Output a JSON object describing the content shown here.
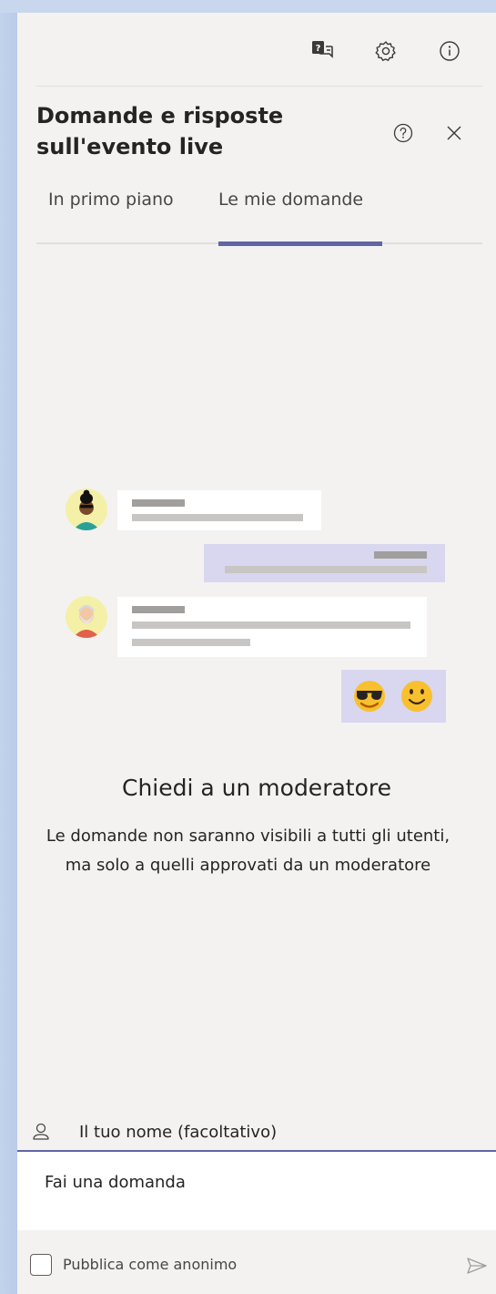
{
  "header": {
    "title": "Domande e risposte sull'evento live",
    "icons": [
      "qna-icon",
      "gear-icon",
      "info-icon"
    ],
    "help_icon": "question-circle-icon",
    "close_icon": "close-icon"
  },
  "tabs": [
    {
      "label": "In primo piano",
      "active": false
    },
    {
      "label": "Le mie domande",
      "active": true
    }
  ],
  "empty_state": {
    "title": "Chiedi a un moderatore",
    "text_line1": "Le domande non saranno visibili a tutti gli utenti,",
    "text_line2": "ma solo a quelli approvati da un moderatore"
  },
  "compose": {
    "name_placeholder": "Il tuo nome (facoltativo)",
    "question_placeholder": "Fai una domanda",
    "anonymous_label": "Pubblica come anonimo",
    "anonymous_checked": false
  },
  "colors": {
    "accent": "#6264a7",
    "panel_bg": "#f3f2f1",
    "frame_bg": "#c8d7ee"
  }
}
